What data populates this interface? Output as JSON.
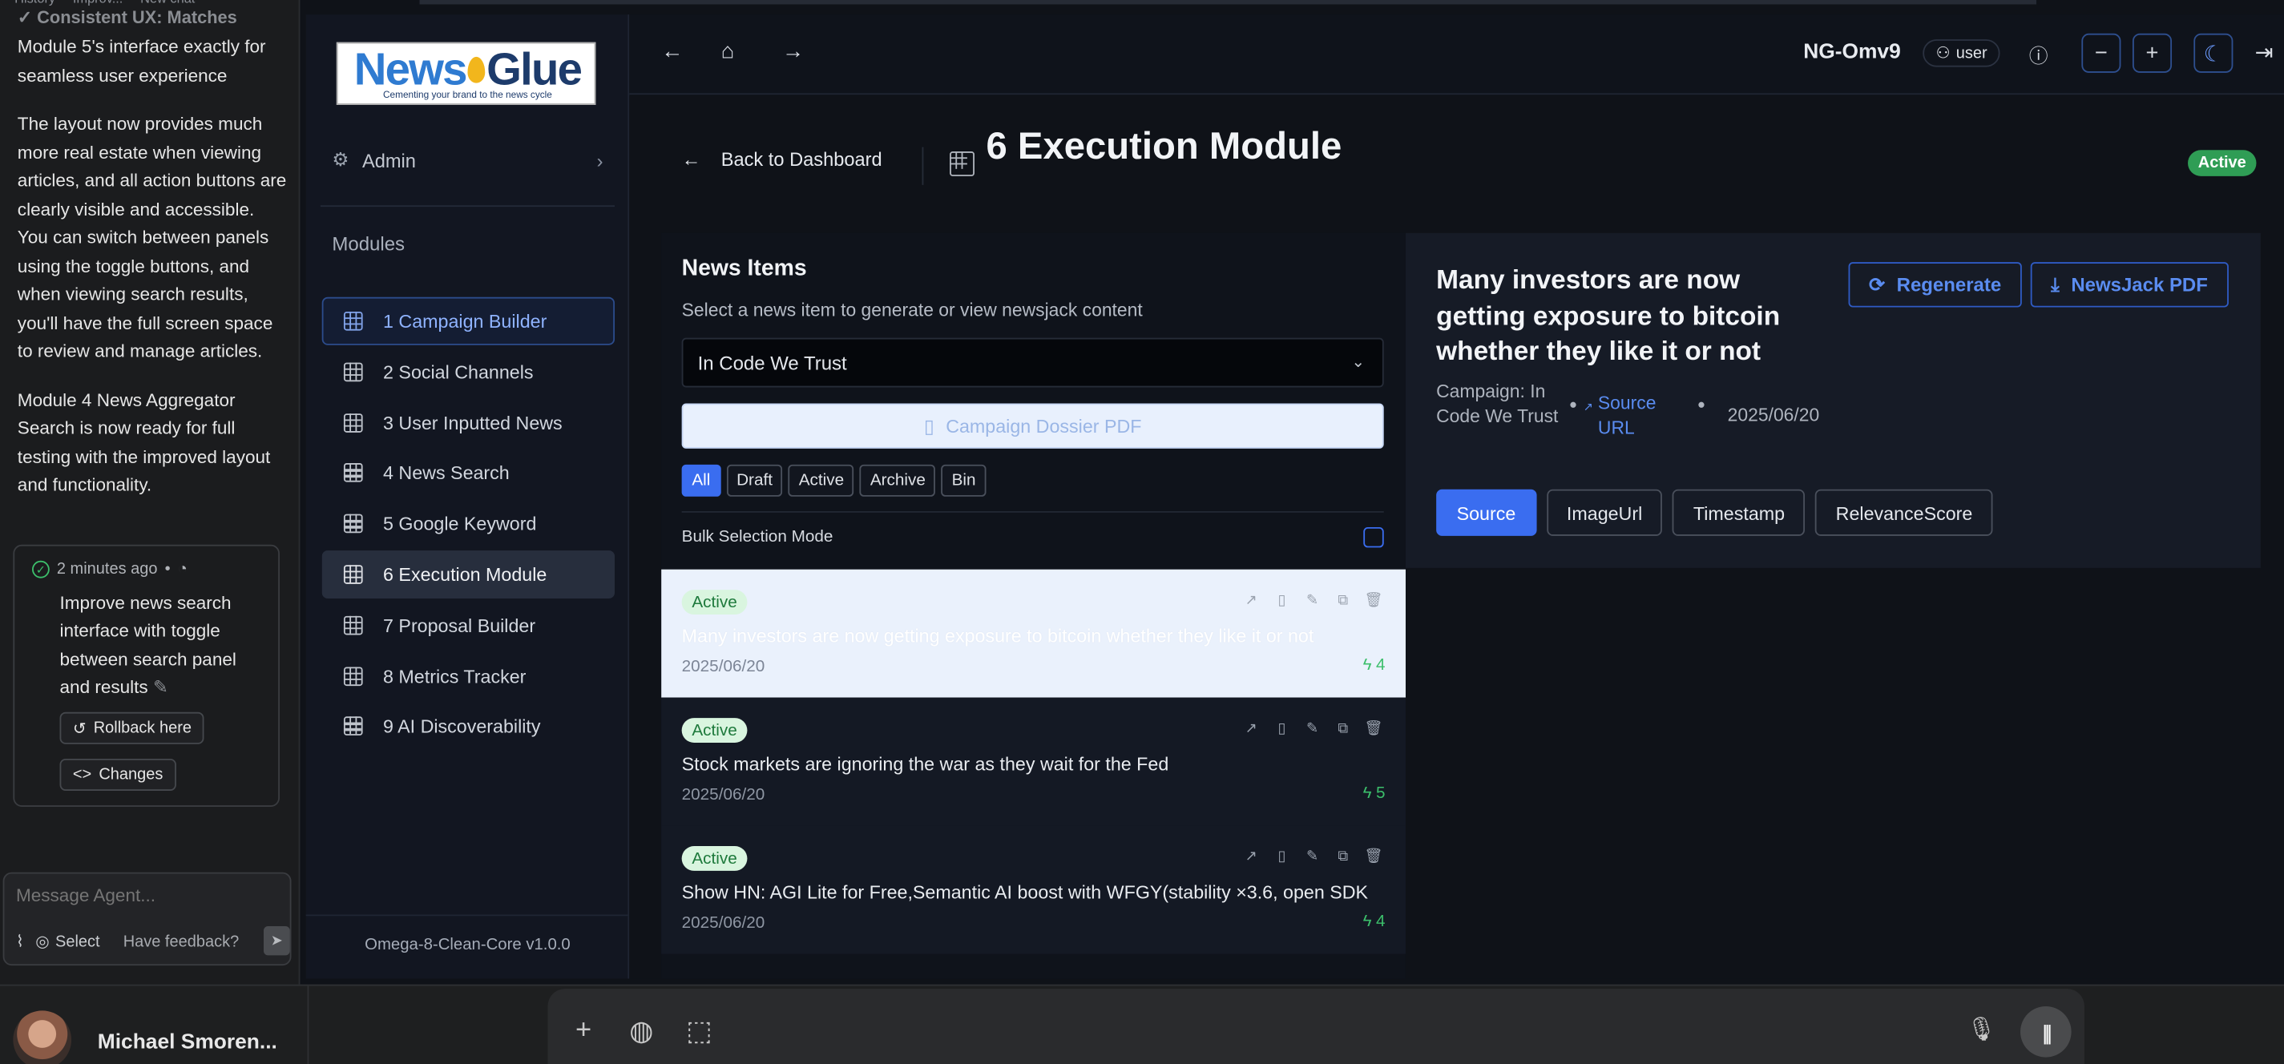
{
  "agent": {
    "tabs": [
      "History",
      "Improv...",
      "New chat"
    ],
    "faded_line": "✓ Consistent UX: Matches",
    "messages": [
      "Module 5's interface exactly for seamless user experience",
      "The layout now provides much more real estate when viewing articles, and all action buttons are clearly visible and accessible. You can switch between panels using the toggle buttons, and when viewing search results, you'll have the full screen space to review and manage articles.",
      "Module 4 News Aggregator Search is now ready for full testing with the improved layout and functionality."
    ],
    "checkpoint": {
      "time": "2 minutes ago",
      "text": "Improve news search interface with toggle between search panel and results",
      "rollback_label": "Rollback here",
      "changes_label": "Changes"
    },
    "input_placeholder": "Message Agent...",
    "select_label": "Select",
    "feedback_label": "Have feedback?"
  },
  "sidebar": {
    "logo_news": "News",
    "logo_glue": "Glue",
    "logo_tagline": "Cementing your brand to the news cycle",
    "admin_label": "Admin",
    "modules_label": "Modules",
    "modules": [
      "1 Campaign Builder",
      "2 Social Channels",
      "3 User Inputted News",
      "4 News Search",
      "5 Google Keyword",
      "6 Execution Module",
      "7 Proposal Builder",
      "8 Metrics Tracker",
      "9 AI Discoverability"
    ],
    "selected_module_index": 0,
    "current_module_index": 5,
    "version": "Omega-8-Clean-Core v1.0.0"
  },
  "topbar": {
    "title": "NG-Omv9",
    "user_label": "user"
  },
  "main": {
    "back_label": "Back to Dashboard",
    "module_title": "6 Execution Module",
    "status": "Active",
    "news": {
      "title": "News Items",
      "subtitle": "Select a news item to generate or view newsjack content",
      "selected_campaign": "In Code We Trust",
      "dossier_label": "Campaign Dossier PDF",
      "filters": [
        "All",
        "Draft",
        "Active",
        "Archive",
        "Bin"
      ],
      "active_filter": "All",
      "bulk_label": "Bulk Selection Mode",
      "items": [
        {
          "status": "Active",
          "headline": "Many investors are now getting exposure to bitcoin whether they like it or not",
          "date": "2025/06/20",
          "score": "4"
        },
        {
          "status": "Active",
          "headline": "Stock markets are ignoring the war as they wait for the Fed",
          "date": "2025/06/20",
          "score": "5"
        },
        {
          "status": "Active",
          "headline": "Show HN: AGI Lite for Free,Semantic AI boost with WFGY(stability ×3.6, open SDK",
          "date": "2025/06/20",
          "score": "4"
        }
      ]
    },
    "detail": {
      "headline": "Many investors are now getting exposure to bitcoin whether they like it or not",
      "regenerate_label": "Regenerate",
      "pdf_label": "NewsJack PDF",
      "campaign_text": "Campaign: In Code We Trust",
      "source_label": "Source URL",
      "date": "2025/06/20",
      "tabs": [
        "Source",
        "ImageUrl",
        "Timestamp",
        "RelevanceScore"
      ],
      "active_tab": "Source"
    }
  },
  "bottom": {
    "user_name": "Michael Smoren..."
  },
  "colors": {
    "accent": "#3a6df0",
    "active_green": "#2f9d55",
    "background": "#0f1218"
  }
}
